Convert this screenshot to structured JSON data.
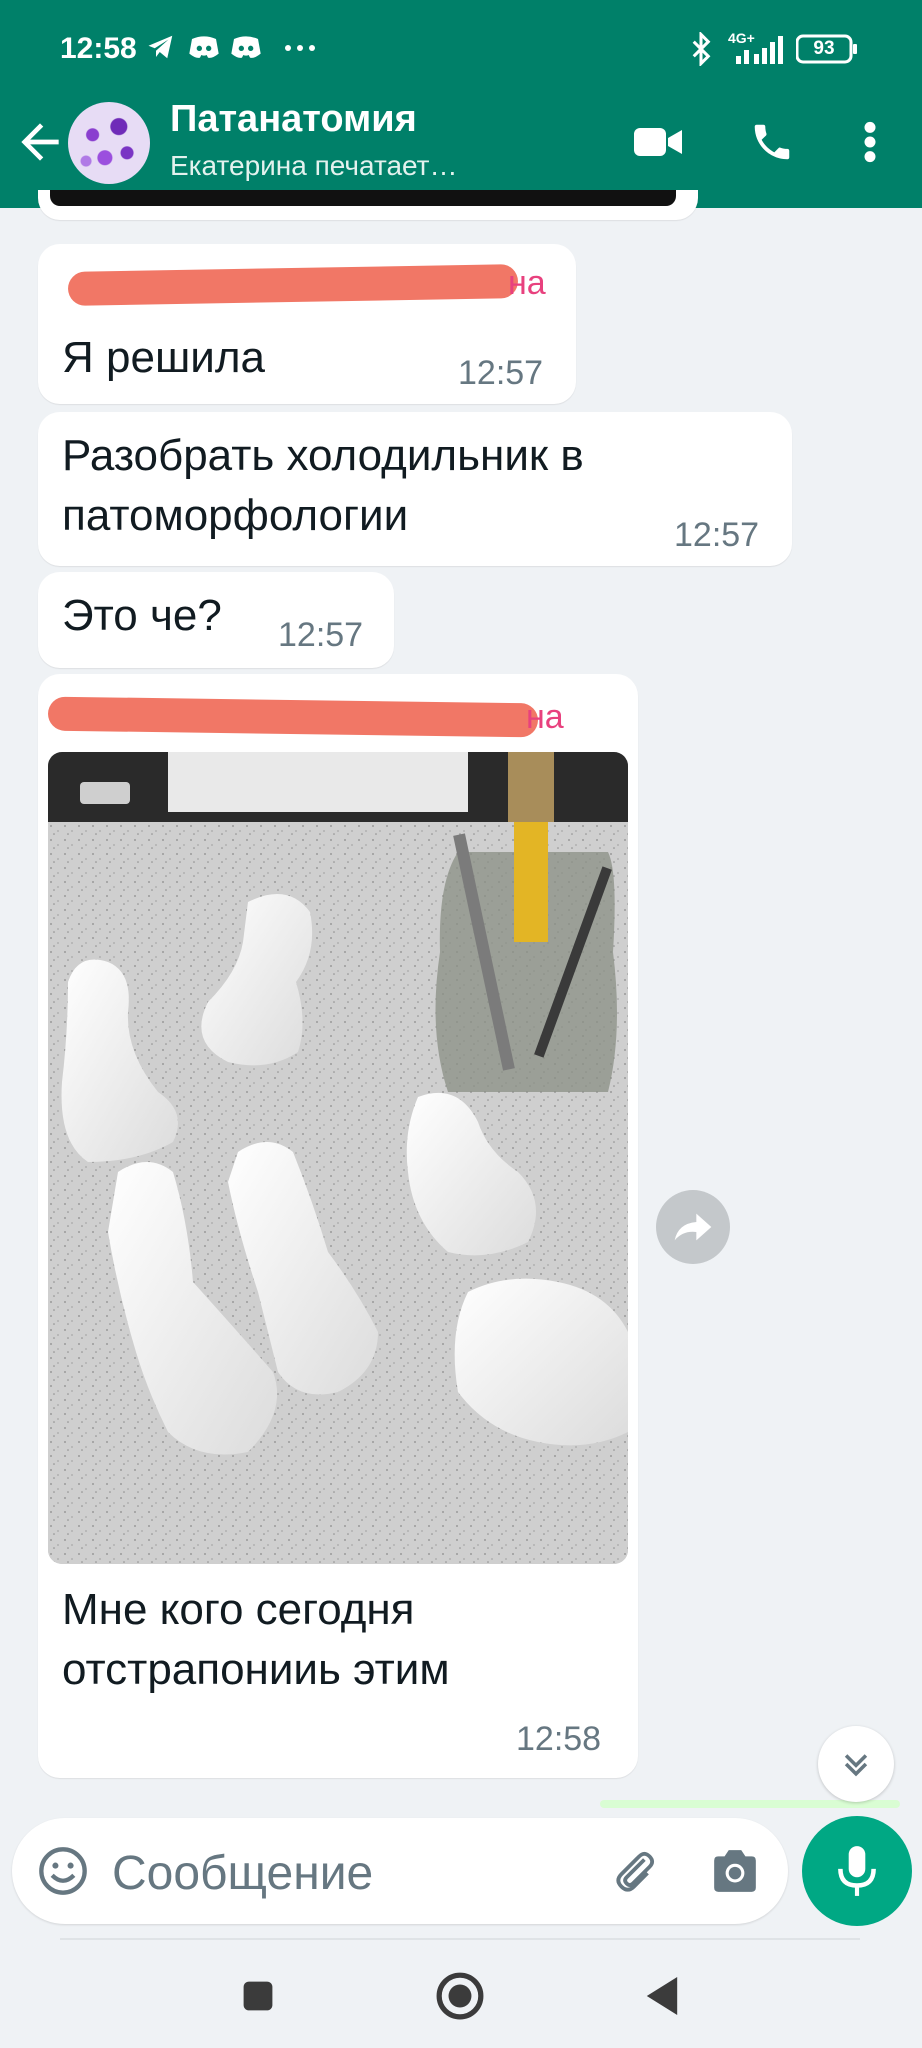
{
  "status_bar": {
    "time": "12:58",
    "network": "4G+",
    "battery": "93",
    "icons": [
      "telegram-icon",
      "discord-icon",
      "discord-icon",
      "more-dots-icon",
      "bluetooth-icon",
      "signal-icon",
      "battery-icon"
    ]
  },
  "header": {
    "title": "Патанатомия",
    "subtitle": "Екатерина печатает…",
    "icons": [
      "back-arrow-icon",
      "video-call-icon",
      "phone-icon",
      "more-vert-icon"
    ]
  },
  "messages": [
    {
      "sender_suffix": "на",
      "text": "Я решила",
      "time": "12:57"
    },
    {
      "text": "Разобрать холодильник в патоморфологии",
      "line1": "Разобрать холодильник в",
      "line2": "патоморфологии",
      "time": "12:57"
    },
    {
      "text": "Это че?",
      "time": "12:57"
    },
    {
      "sender_suffix": "на",
      "line1": "Мне кого сегодня",
      "line2": "отстрапонииь этим",
      "time": "12:58"
    }
  ],
  "composer": {
    "placeholder": "Сообщение",
    "icons": [
      "emoji-icon",
      "attach-icon",
      "camera-icon",
      "mic-icon"
    ]
  },
  "colors": {
    "header": "#008069",
    "accent": "#00a884",
    "chat_bg": "#eff2f5",
    "bubble": "#ffffff",
    "sender": "#e8417e"
  }
}
